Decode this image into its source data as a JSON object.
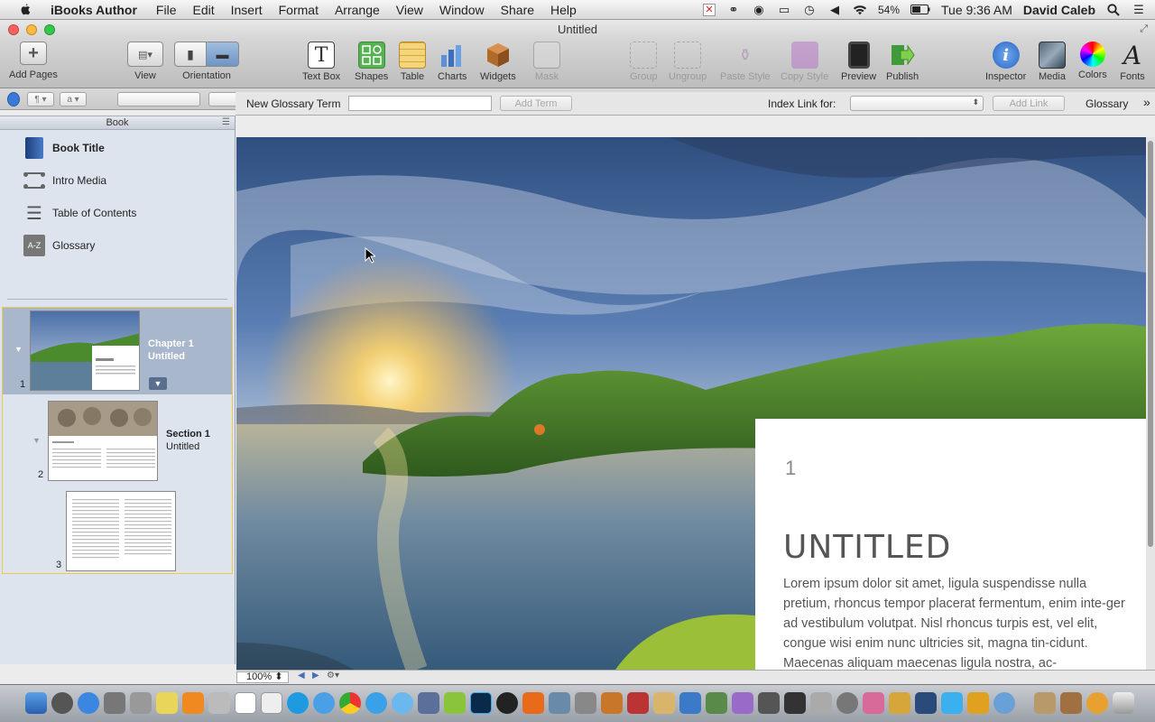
{
  "menubar": {
    "app_name": "iBooks Author",
    "items": [
      "File",
      "Edit",
      "Insert",
      "Format",
      "Arrange",
      "View",
      "Window",
      "Share",
      "Help"
    ],
    "battery": "54%",
    "clock": "Tue 9:36 AM",
    "user": "David Caleb"
  },
  "window": {
    "title": "Untitled"
  },
  "toolbar": {
    "add_pages": "Add Pages",
    "view": "View",
    "orientation": "Orientation",
    "text_box": "Text Box",
    "shapes": "Shapes",
    "table": "Table",
    "charts": "Charts",
    "widgets": "Widgets",
    "mask": "Mask",
    "group": "Group",
    "ungroup": "Ungroup",
    "paste_style": "Paste Style",
    "copy_style": "Copy Style",
    "preview": "Preview",
    "publish": "Publish",
    "inspector": "Inspector",
    "media": "Media",
    "colors": "Colors",
    "fonts": "Fonts"
  },
  "glossary_bar": {
    "new_term_label": "New Glossary Term",
    "add_term": "Add Term",
    "index_link_label": "Index Link for:",
    "add_link": "Add Link",
    "glossary": "Glossary"
  },
  "sidebar": {
    "header": "Book",
    "items": [
      {
        "label": "Book Title"
      },
      {
        "label": "Intro Media"
      },
      {
        "label": "Table of Contents"
      },
      {
        "label": "Glossary",
        "icon_text": "A-Z"
      }
    ],
    "chapter": {
      "title": "Chapter 1",
      "subtitle": "Untitled",
      "page": "1"
    },
    "section": {
      "title": "Section 1",
      "subtitle": "Untitled",
      "page": "2"
    },
    "page3": {
      "page": "3"
    }
  },
  "canvas": {
    "chapter_number": "1",
    "chapter_title": "UNTITLED",
    "body": "Lorem ipsum dolor sit amet, ligula suspendisse nulla pretium, rhoncus tempor placerat fermentum, enim inte-ger ad vestibulum volutpat. Nisl rhoncus turpis est, vel elit, congue wisi enim nunc ultricies sit, magna tin-cidunt. Maecenas aliquam maecenas ligula nostra, ac-"
  },
  "status": {
    "zoom": "100%"
  }
}
